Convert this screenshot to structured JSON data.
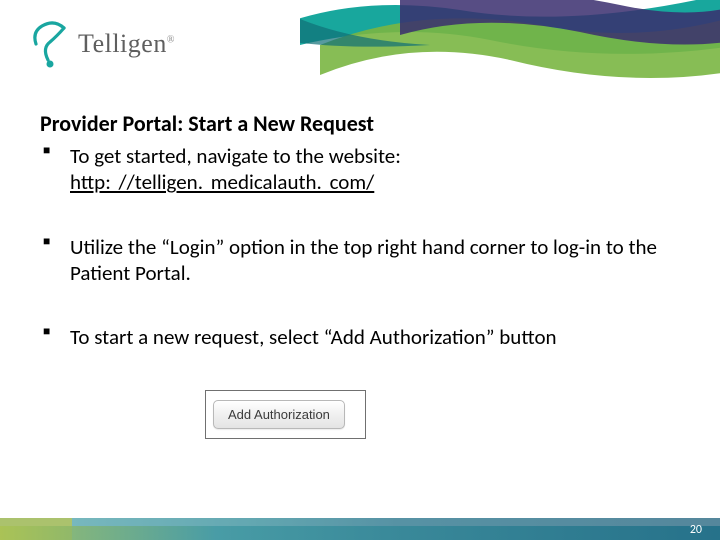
{
  "logo": {
    "text": "Telligen",
    "registered": "®"
  },
  "title": "Provider Portal:  Start a New Request",
  "bullets": [
    {
      "text_before": "To get started, navigate to the website: ",
      "link": "http: //telligen. medicalauth. com/",
      "text_after": ""
    },
    {
      "text_before": "Utilize the “Login” option in the top right hand corner to log-in to the Patient Portal.",
      "link": "",
      "text_after": ""
    },
    {
      "text_before": "To start a new request, select “Add Authorization” button",
      "link": "",
      "text_after": ""
    }
  ],
  "button": {
    "label": "Add Authorization"
  },
  "footer": {
    "page": "20"
  }
}
